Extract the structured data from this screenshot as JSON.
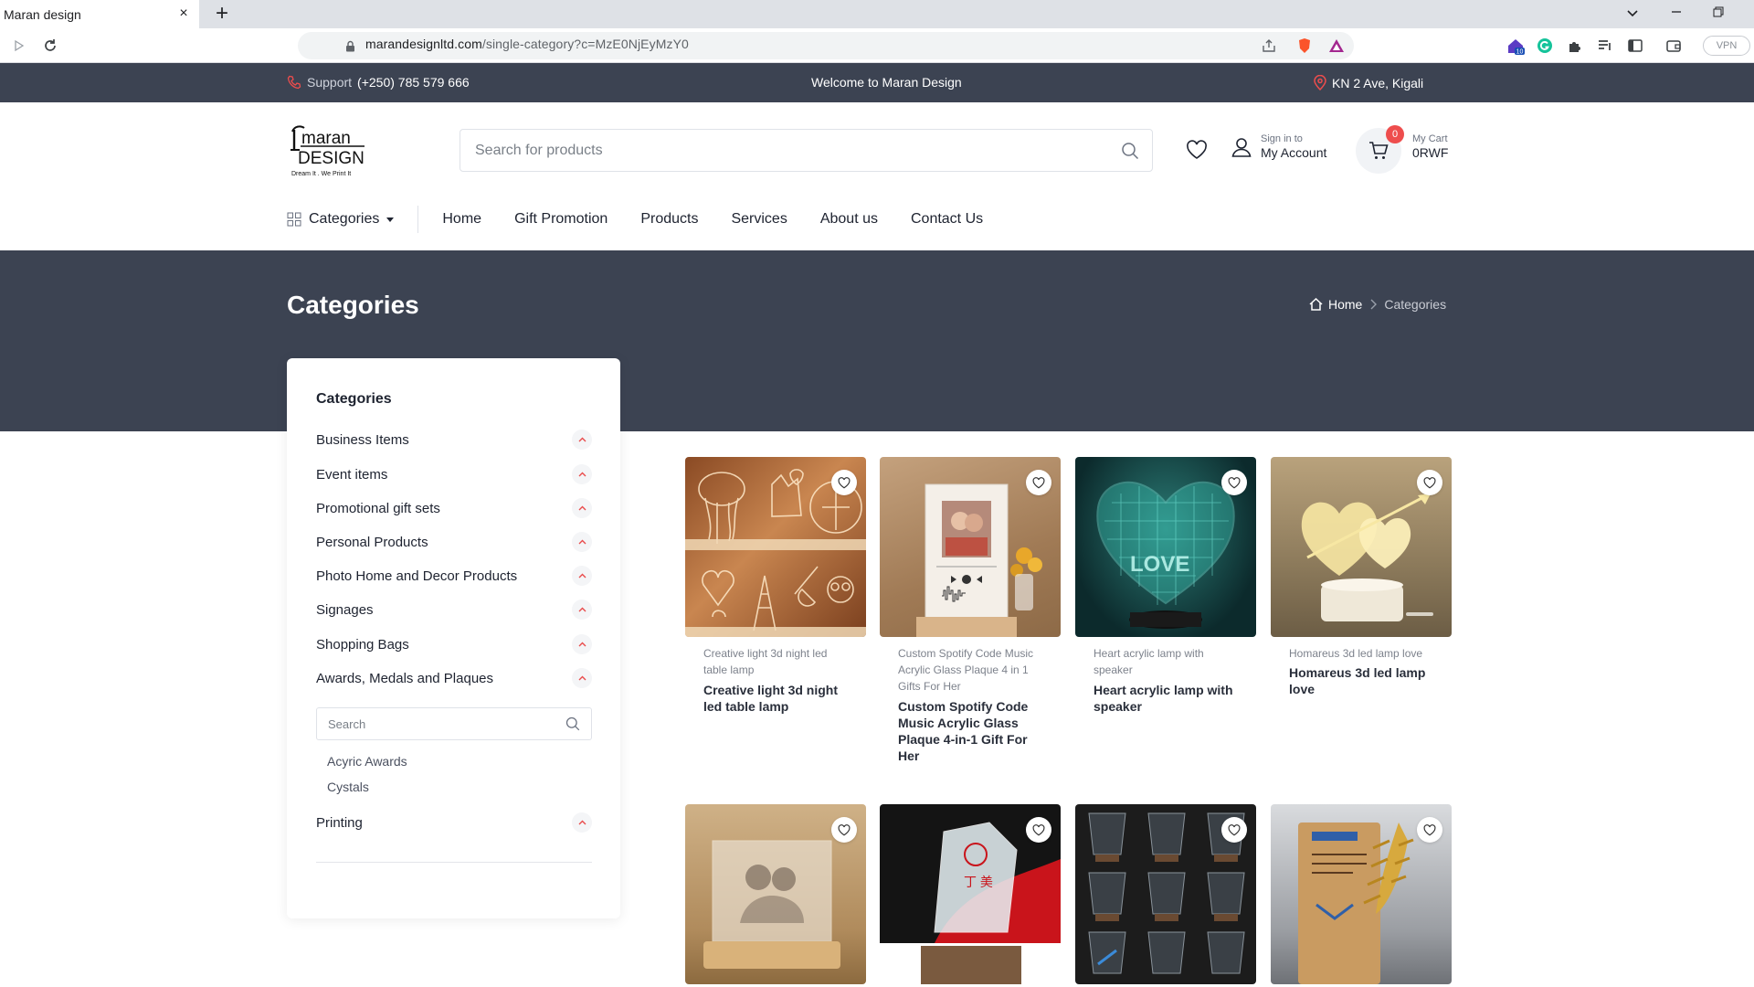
{
  "browser": {
    "tab_title": "Maran design",
    "tab_close": "×",
    "new_tab": "+",
    "url_domain": "marandesignltd.com",
    "url_path": "/single-category?c=MzE0NjEyMzY0",
    "vpn_label": "VPN",
    "extension_badge": "10"
  },
  "topbar": {
    "support_label": "Support",
    "support_phone": "(+250) 785 579 666",
    "welcome": "Welcome to Maran Design",
    "location": "KN 2 Ave, Kigali"
  },
  "header": {
    "logo_text_top": "maran",
    "logo_text_bottom": "DESIGN",
    "logo_tagline": "Dream It . We Print It",
    "search_placeholder": "Search for products",
    "account_small": "Sign in to",
    "account_big": "My Account",
    "cart_count": "0",
    "cart_small": "My Cart",
    "cart_big": "0RWF"
  },
  "nav": {
    "categories_label": "Categories",
    "items": [
      "Home",
      "Gift Promotion",
      "Products",
      "Services",
      "About us",
      "Contact Us"
    ]
  },
  "hero": {
    "title": "Categories",
    "breadcrumb_home": "Home",
    "breadcrumb_current": "Categories"
  },
  "sidebar": {
    "title": "Categories",
    "items": [
      "Business Items",
      "Event items",
      "Promotional gift sets",
      "Personal Products",
      "Photo Home and Decor Products",
      "Signages",
      "Shopping Bags",
      "Awards, Medals and Plaques"
    ],
    "search_placeholder": "Search",
    "subitems": [
      "Acyric Awards",
      "Cystals"
    ],
    "last_item": "Printing"
  },
  "products": [
    {
      "subtitle": "Creative light 3d night led table lamp",
      "name": "Creative light 3d night led table lamp"
    },
    {
      "subtitle": "Custom Spotify Code Music Acrylic Glass Plaque 4 in 1 Gifts For Her",
      "name": "Custom Spotify Code Music Acrylic Glass Plaque 4-in-1 Gift For Her"
    },
    {
      "subtitle": "Heart acrylic lamp with speaker",
      "name": "Heart acrylic lamp with speaker"
    },
    {
      "subtitle": "Homareus 3d led lamp love",
      "name": "Homareus 3d led lamp love"
    }
  ],
  "theme": {
    "dark_band": "#3c4352",
    "accent_red": "#e94b4b"
  }
}
